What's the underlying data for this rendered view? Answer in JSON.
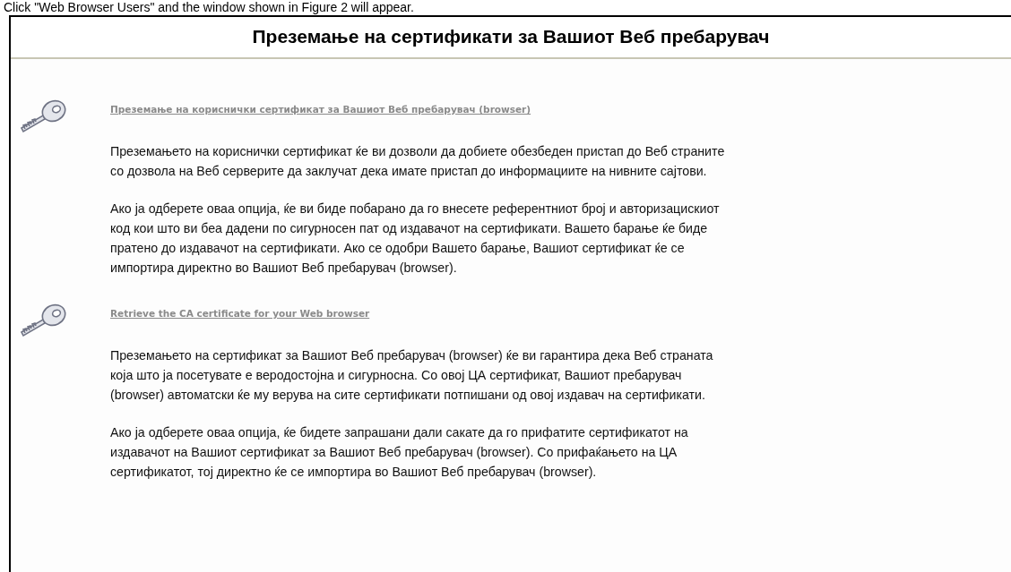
{
  "caption": "Click \"Web Browser Users\" and the window shown in Figure 2 will appear.",
  "page": {
    "title": "Преземање на сертификати за Вашиот Веб пребарувач",
    "sections": [
      {
        "link": "Преземање на кориснички сертификат за Вашиот Веб пребарувач (browser)",
        "paragraphs": [
          [
            "Преземањето на кориснички сертификат ќе ви дозволи да добиете обезбеден пристап до Веб страните",
            "со дозвола на Веб серверите да заклучат дека имате пристап до информациите на нивните сајтови."
          ],
          [
            "Ако ја одберете оваа опција, ќе ви биде побарано да го внесете референтниот број и авторизацискиот",
            "код кои што ви беа дадени по сигурносен пат од издавачот на сертификати. Вашето барање ќе биде",
            "пратено до издавачот на сертификати. Ако се одобри Вашето барање, Вашиот сертификат ќе се",
            "импортира директно во Вашиот Веб пребарувач (browser)."
          ]
        ]
      },
      {
        "link": "Retrieve the CA certificate for your Web browser",
        "paragraphs": [
          [
            "Преземањето на сертификат за Вашиот Веб пребарувач (browser) ќе ви гарантира дека Веб страната",
            "која што ја посетувате е веродостојна и сигурносна. Со овој ЦА сертификат, Вашиот пребарувач",
            "(browser) автоматски ќе му верува на сите сертификати потпишани од овој издавач на сертификати."
          ],
          [
            "Ако ја одберете оваа опција, ќе бидете запрашани дали сакате да го прифатите сертификатот на",
            "издавачот на Вашиот сертификат за Вашиот Веб пребарувач (browser). Со прифаќањето на ЦА",
            "сертификатот, тој директно ќе се импортира во Вашиот Веб пребарувач (browser)."
          ]
        ]
      }
    ]
  }
}
